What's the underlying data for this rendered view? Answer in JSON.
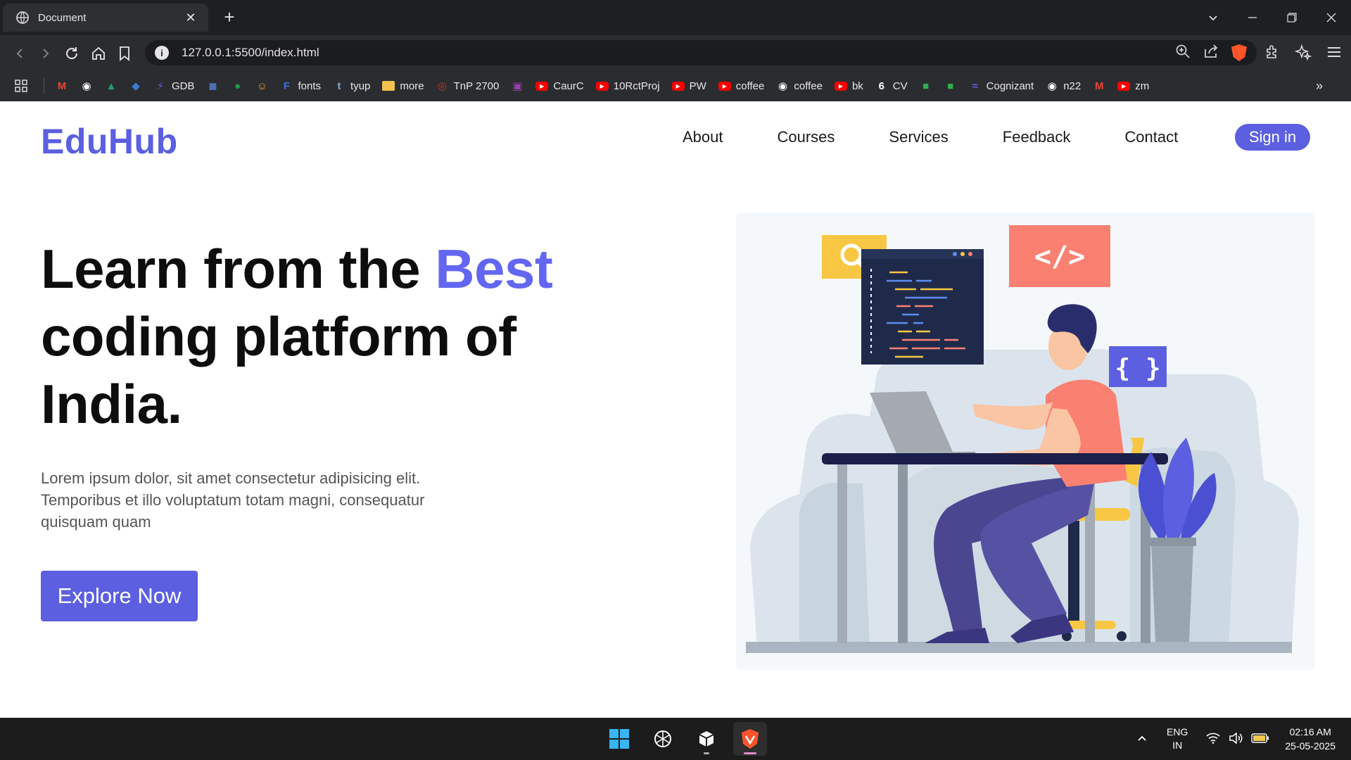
{
  "browser": {
    "tab_title": "Document",
    "url": "127.0.0.1:5500/index.html",
    "icons": [
      "globe-icon",
      "close-icon",
      "plus-icon",
      "chevron-down-icon",
      "minimize-icon",
      "restore-icon",
      "close-window-icon",
      "back-icon",
      "forward-icon",
      "reload-icon",
      "home-icon",
      "bookmark-icon",
      "info-icon",
      "zoom-icon",
      "share-icon",
      "brave-shield-icon",
      "extensions-icon",
      "leo-icon",
      "menu-icon"
    ],
    "bookmarks": [
      {
        "label": "",
        "icon": "gmail-icon",
        "color": "#ea4335"
      },
      {
        "label": "",
        "icon": "github-icon",
        "color": "#ffffff"
      },
      {
        "label": "",
        "icon": "drive-icon",
        "color": "#1fa463"
      },
      {
        "label": "",
        "icon": "app-icon",
        "color": "#3a7bd5"
      },
      {
        "label": "GDB",
        "icon": "lightning-icon",
        "color": "#6b4fd8"
      },
      {
        "label": "",
        "icon": "game-icon",
        "color": "#4a6fb3"
      },
      {
        "label": "",
        "icon": "globe-green-icon",
        "color": "#1b9e4b"
      },
      {
        "label": "",
        "icon": "emoji-icon",
        "color": "#e0a030"
      },
      {
        "label": "fonts",
        "icon": "f-icon",
        "color": "#3b6de0"
      },
      {
        "label": "tyup",
        "icon": "t-icon",
        "color": "#7fa9d8"
      },
      {
        "label": "more",
        "icon": "folder-icon",
        "color": "#f2c14e"
      },
      {
        "label": "TnP 2700",
        "icon": "tnp-icon",
        "color": "#c0392b"
      },
      {
        "label": "",
        "icon": "square-icon",
        "color": "#9b3fb5"
      },
      {
        "label": "CaurC",
        "icon": "youtube-icon",
        "color": "#ff0000"
      },
      {
        "label": "10RctProj",
        "icon": "youtube-icon",
        "color": "#ff0000"
      },
      {
        "label": "PW",
        "icon": "youtube-icon",
        "color": "#ff0000"
      },
      {
        "label": "coffee",
        "icon": "youtube-icon",
        "color": "#ff0000"
      },
      {
        "label": "coffee",
        "icon": "github-icon",
        "color": "#ffffff"
      },
      {
        "label": "bk",
        "icon": "youtube-icon",
        "color": "#ff0000"
      },
      {
        "label": "CV",
        "icon": "cv-icon",
        "color": "#ffffff"
      },
      {
        "label": "",
        "icon": "green-app-icon",
        "color": "#2fb14b"
      },
      {
        "label": "",
        "icon": "green-app-icon",
        "color": "#2fb14b"
      },
      {
        "label": "Cognizant",
        "icon": "cognizant-icon",
        "color": "#5a5ff0"
      },
      {
        "label": "n22",
        "icon": "github-icon",
        "color": "#ffffff"
      },
      {
        "label": "",
        "icon": "gmail-icon",
        "color": "#ea4335"
      },
      {
        "label": "zm",
        "icon": "youtube-icon",
        "color": "#ff0000"
      }
    ],
    "more_chevron": "»"
  },
  "site": {
    "logo": "EduHub",
    "nav": [
      "About",
      "Courses",
      "Services",
      "Feedback",
      "Contact"
    ],
    "signin": "Sign in",
    "hero": {
      "title_part1": "Learn from the ",
      "title_accent": "Best",
      "title_part2": "coding platform of India.",
      "text": "Lorem ipsum dolor, sit amet consectetur adipisicing elit. Temporibus et illo voluptatum totam magni, consequatur quisquam quam",
      "cta": "Explore Now"
    },
    "illustration": {
      "icon": "developer-at-desk-illustration",
      "code_tag": "</>",
      "braces": "{ }",
      "colors": {
        "accent": "#5b5fe0",
        "coral": "#fa8072",
        "yellow": "#f7c744",
        "navy": "#1f2a4a"
      }
    }
  },
  "taskbar": {
    "apps": [
      "windows-start-icon",
      "chatgpt-icon",
      "terminal-app-icon",
      "brave-browser-icon"
    ],
    "lang_line1": "ENG",
    "lang_line2": "IN",
    "time": "02:16 AM",
    "date": "25-05-2025"
  }
}
